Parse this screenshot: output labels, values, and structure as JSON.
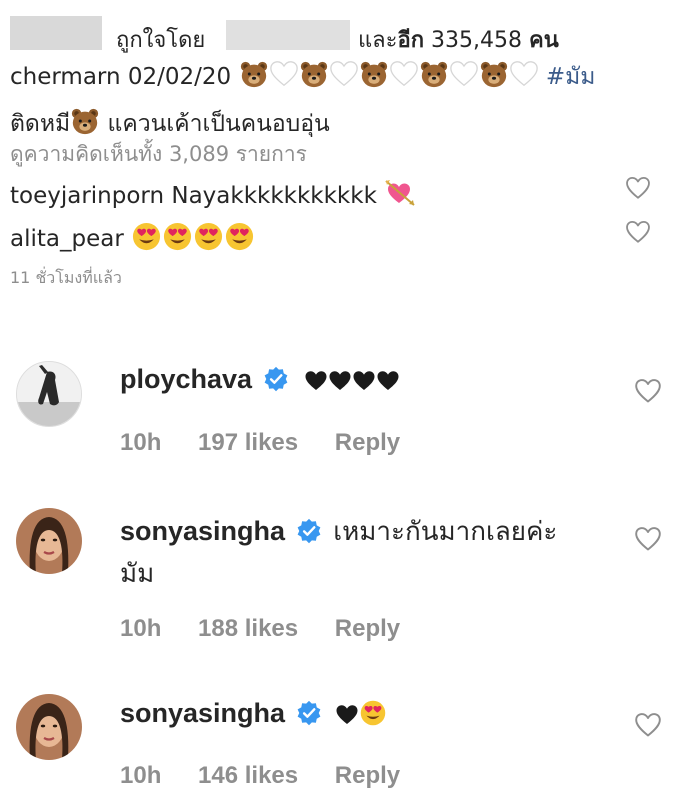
{
  "likes_summary": {
    "liked_by_prefix": "ถูกใจโดย",
    "and_text": "และ",
    "others_label": "อีก",
    "count": "335,458",
    "unit": "คน"
  },
  "caption": {
    "username": "chermarn",
    "date": "02/02/20",
    "hashtag": "#มัม",
    "line2_text": "ติดหมี",
    "line2_rest": "แควนเค้าเป็นคนอบอุ่น"
  },
  "view_all_comments": "ดูความคิดเห็นทั้ง 3,089 รายการ",
  "inline_comments": [
    {
      "username": "toeyjarinporn",
      "text": "Nayakkkkkkkkkkk"
    },
    {
      "username": "alita_pear",
      "text": ""
    }
  ],
  "time_ago": "11 ชั่วโมงที่แล้ว",
  "comments": [
    {
      "username": "ploychava",
      "text": "",
      "time": "10h",
      "likes": "197 likes",
      "reply": "Reply"
    },
    {
      "username": "sonyasingha",
      "text": "เหมาะกันมากเลยค่ะ",
      "text2": "มัม",
      "time": "10h",
      "likes": "188 likes",
      "reply": "Reply"
    },
    {
      "username": "sonyasingha",
      "text": "",
      "time": "10h",
      "likes": "146 likes",
      "reply": "Reply"
    }
  ],
  "icons": {
    "bear": "bear-face-icon",
    "white_heart": "white-heart-icon",
    "heart_arrow": "heart-with-arrow-icon",
    "heart_eyes": "heart-eyes-face-icon",
    "black_heart": "black-heart-icon",
    "verified": "verified-badge-icon",
    "like": "heart-outline-icon"
  },
  "colors": {
    "verified_blue": "#3897f0",
    "muted_text": "#8e8e8e",
    "hashtag": "#3b5b8a"
  }
}
